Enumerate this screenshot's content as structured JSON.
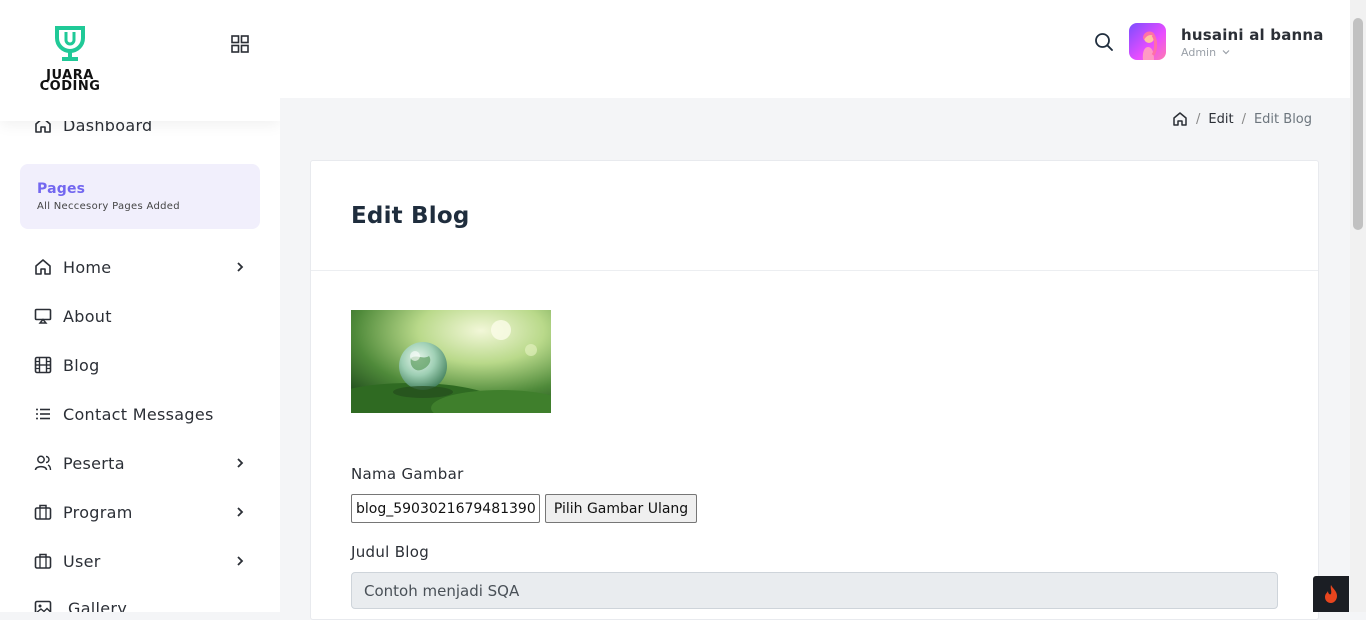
{
  "brand": {
    "logo_text": "JUARA CODING",
    "accent": "#20c997"
  },
  "sidebar": {
    "dashboard": "Dashboard",
    "pages_title": "Pages",
    "pages_sub": "All Neccesory Pages Added",
    "items": [
      {
        "label": "Home",
        "icon": "home-icon",
        "has_children": true
      },
      {
        "label": "About",
        "icon": "monitor-icon",
        "has_children": false
      },
      {
        "label": "Blog",
        "icon": "film-icon",
        "has_children": false
      },
      {
        "label": "Contact Messages",
        "icon": "list-icon",
        "has_children": false
      },
      {
        "label": "Peserta",
        "icon": "users-icon",
        "has_children": true
      },
      {
        "label": "Program",
        "icon": "briefcase-icon",
        "has_children": true
      },
      {
        "label": "User",
        "icon": "briefcase-icon",
        "has_children": true
      },
      {
        "label": "Gallery",
        "icon": "image-icon",
        "has_children": false
      }
    ]
  },
  "header": {
    "user_name": "husaini al banna",
    "user_role": "Admin"
  },
  "breadcrumb": {
    "edit": "Edit",
    "current": "Edit Blog"
  },
  "form": {
    "title": "Edit Blog",
    "image_label": "Nama Gambar",
    "file_value": "blog_5903021679481390_",
    "file_button": "Pilih Gambar Ulang",
    "judul_label": "Judul Blog",
    "judul_value": "Contoh menjadi SQA"
  }
}
